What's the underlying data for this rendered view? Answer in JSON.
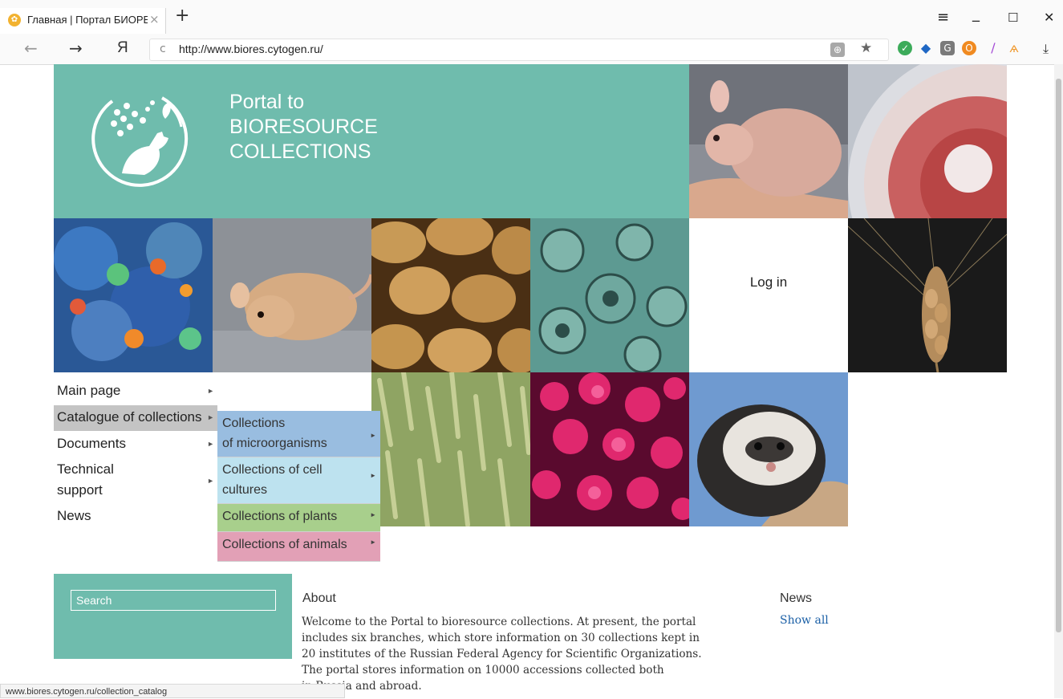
{
  "browser": {
    "tab_title": "Главная | Портал БИОРЕ",
    "tab_close": "×",
    "new_tab": "+",
    "url": "http://www.biores.cytogen.ru/",
    "yandex": "Я",
    "menu_glyph": "≡",
    "minimize_glyph": "_",
    "maximize_glyph": "☐",
    "close_glyph": "✕",
    "back_glyph": "←",
    "forward_glyph": "→",
    "reload_glyph": "c",
    "star_glyph": "★",
    "download_glyph": "⤓"
  },
  "header": {
    "title_lines": [
      "Portal  to",
      "BIORESOURCE",
      "COLLECTIONS"
    ],
    "accent_color": "#6fbcad"
  },
  "login": {
    "label": "Log in"
  },
  "menu": {
    "items": [
      {
        "label": "Main page"
      },
      {
        "label": "Catalogue of collections"
      },
      {
        "label": "Documents"
      },
      {
        "label_lines": [
          "Technical",
          "support"
        ]
      },
      {
        "label": "News"
      }
    ],
    "arrow": "►",
    "submenu": [
      {
        "label_lines": [
          "Collections",
          "of microorganisms"
        ],
        "color": "#99bde0"
      },
      {
        "label_lines": [
          "Collections of cell",
          "cultures"
        ],
        "color": "#bde2ef"
      },
      {
        "label_lines": [
          "Collections of plants"
        ],
        "color": "#a8cf8c"
      },
      {
        "label_lines": [
          "Collections of animals"
        ],
        "color": "#e2a0b6"
      }
    ]
  },
  "search": {
    "placeholder": "Search"
  },
  "about": {
    "heading": "About",
    "lines": [
      "Welcome to the Portal to bioresource collections. At present, the portal",
      "includes six branches, which store information on 30 collections kept in",
      "20 institutes of the Russian Federal Agency for Scientific Organizations.",
      "The portal stores information on 10000 accessions collected both",
      "in Russia and abroad."
    ]
  },
  "news": {
    "heading": "News",
    "show_all": "Show all"
  },
  "status_bar": "www.biores.cytogen.ru/collection_catalog",
  "images": [
    "hairless-mouse-photo",
    "petri-dish-photo",
    "fluorescent-cells-photo",
    "mouse-photo",
    "potatoes-photo",
    "micrograph-photo",
    "wheat-ear-photo",
    "wheat-field-photo",
    "pink-cells-photo",
    "polecat-photo"
  ]
}
